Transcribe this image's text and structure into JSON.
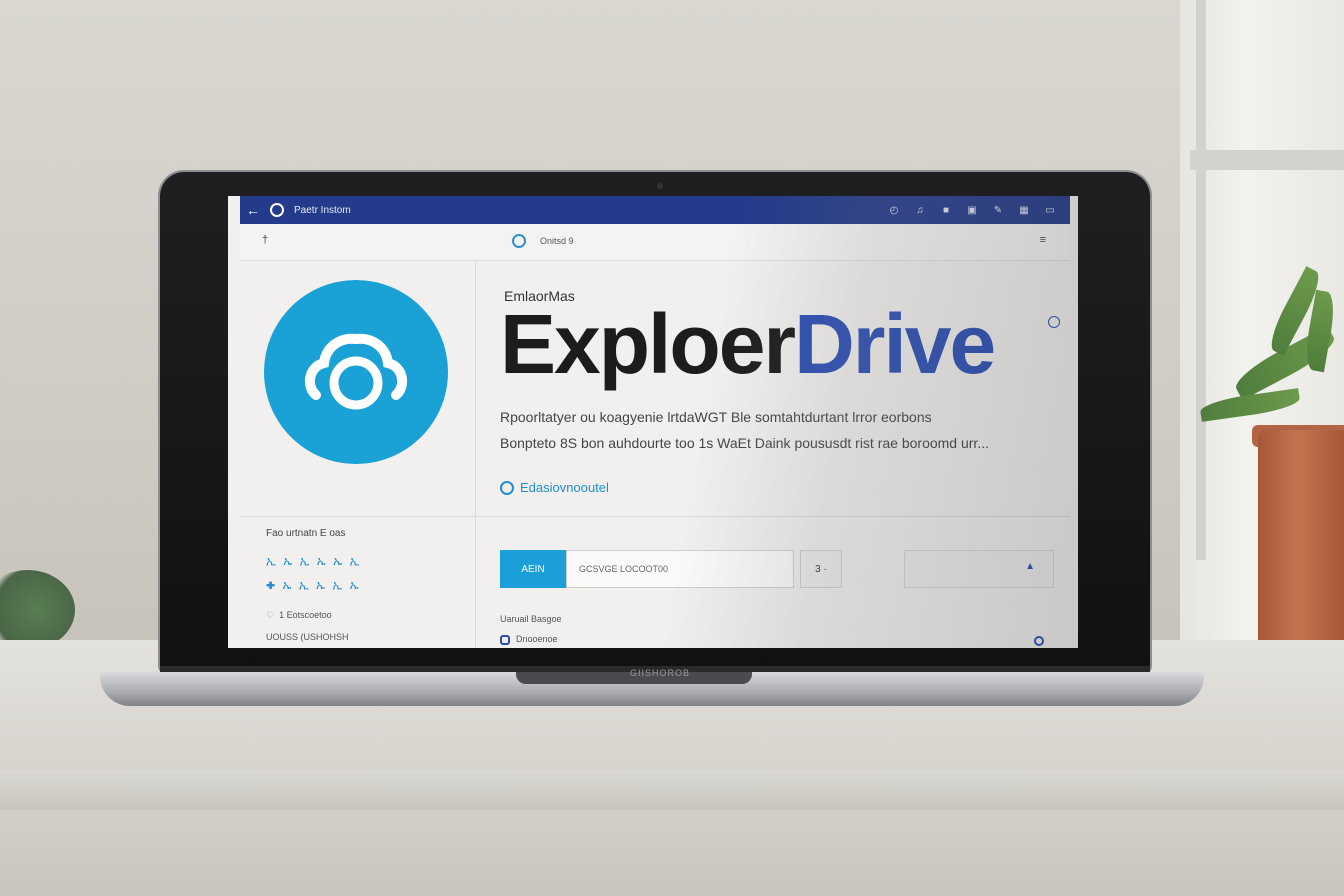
{
  "topbar": {
    "back_icon": "arrow-left-icon",
    "title": "Paetr Instom",
    "icons": [
      "clock-icon",
      "sound-icon",
      "bookmark-icon",
      "window-icon",
      "pen-icon",
      "grid-icon",
      "monitor-icon"
    ]
  },
  "subbar": {
    "label": "Onitsd 9"
  },
  "brand": {
    "small": "EmlaorMas",
    "big_primary": "Exploer",
    "big_accent": "Drive"
  },
  "description": {
    "line1": "Rpoorltatyer ou koagyenie lrtdaWGT Ble somtahtdurtant lrror eorbons",
    "line2": "Bonpteto 8S bon auhdourte too 1s WaEt Daink poususdt rist rae boroomd urr..."
  },
  "link": {
    "label": "Edasiovnooutel"
  },
  "sidebar": {
    "title": "Fao urtnatn E oas",
    "row1": "ኢ ኤ ኢ ኤ ኤ ኢ",
    "row2": "✚ ኤ ኢ ኤ ኢ ኤ",
    "foot1": "1 Eotscoetoo",
    "foot2": "UOUSS (USHOHSH"
  },
  "search": {
    "button": "AEIN",
    "field": "GCSVGE LOCOOT00",
    "button2": "3 ·"
  },
  "list": {
    "header": "Uaruail Basgoe",
    "item1": "Dnooenoe"
  },
  "laptop_brand": "GIISHOROB",
  "colors": {
    "topbar": "#243a8a",
    "logo": "#1aa2d6",
    "accent": "#2a4eb4",
    "link": "#1f8fd0"
  }
}
